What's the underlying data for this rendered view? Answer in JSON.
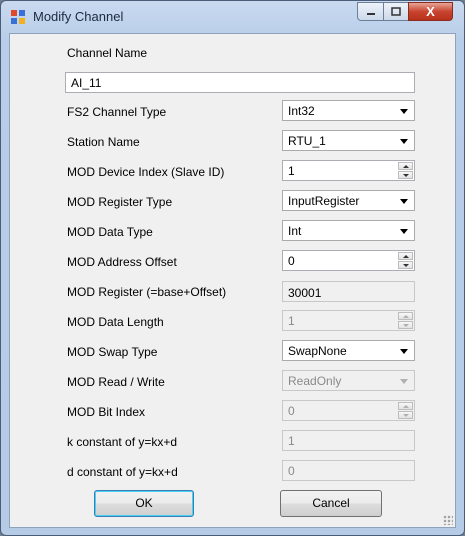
{
  "window": {
    "title": "Modify Channel",
    "close_symbol": "X"
  },
  "form": {
    "channel_name": {
      "label": "Channel Name",
      "value": "AI_11"
    },
    "fs2_channel_type": {
      "label": "FS2 Channel Type",
      "value": "Int32"
    },
    "station_name": {
      "label": "Station Name",
      "value": "RTU_1"
    },
    "mod_device_index": {
      "label": "MOD Device Index (Slave ID)",
      "value": "1"
    },
    "mod_register_type": {
      "label": "MOD Register Type",
      "value": "InputRegister"
    },
    "mod_data_type": {
      "label": "MOD Data Type",
      "value": "Int"
    },
    "mod_address_offset": {
      "label": "MOD Address Offset",
      "value": "0"
    },
    "mod_register": {
      "label": "MOD Register (=base+Offset)",
      "value": "30001"
    },
    "mod_data_length": {
      "label": "MOD Data Length",
      "value": "1"
    },
    "mod_swap_type": {
      "label": "MOD Swap Type",
      "value": "SwapNone"
    },
    "mod_read_write": {
      "label": "MOD Read / Write",
      "value": "ReadOnly"
    },
    "mod_bit_index": {
      "label": "MOD Bit Index",
      "value": "0"
    },
    "k_constant": {
      "label": "k constant of y=kx+d",
      "value": "1"
    },
    "d_constant": {
      "label": "d constant of y=kx+d",
      "value": "0"
    }
  },
  "buttons": {
    "ok": "OK",
    "cancel": "Cancel"
  }
}
